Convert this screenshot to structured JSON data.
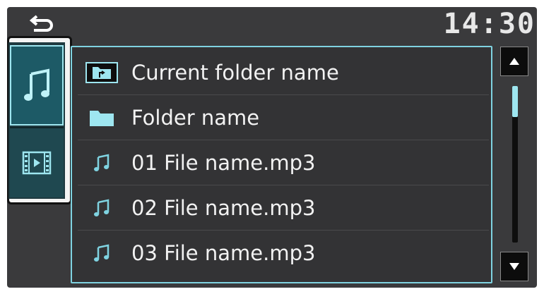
{
  "status_bar": {
    "back_icon": "return-arrow-icon",
    "clock": "14:30"
  },
  "media_type_selector": {
    "items": [
      {
        "name": "music",
        "icon": "music-note-icon",
        "selected": true
      },
      {
        "name": "video",
        "icon": "film-strip-icon",
        "selected": false
      }
    ]
  },
  "file_list": {
    "items": [
      {
        "type": "current-folder",
        "icon": "folder-up-icon",
        "label": "Current folder name"
      },
      {
        "type": "folder",
        "icon": "folder-icon",
        "label": "Folder name"
      },
      {
        "type": "audio-file",
        "icon": "music-note-icon",
        "label": "01 File name.mp3"
      },
      {
        "type": "audio-file",
        "icon": "music-note-icon",
        "label": "02 File name.mp3"
      },
      {
        "type": "audio-file",
        "icon": "music-note-icon",
        "label": "03 File name.mp3"
      }
    ]
  },
  "scrollbar": {
    "up_icon": "triangle-up-icon",
    "down_icon": "triangle-down-icon",
    "thumb_fraction": 0.2,
    "thumb_position": 0.0
  },
  "colors": {
    "accent": "#7fd3e1",
    "background": "#3a3a3c",
    "selected_tab": "#1d5a66"
  }
}
